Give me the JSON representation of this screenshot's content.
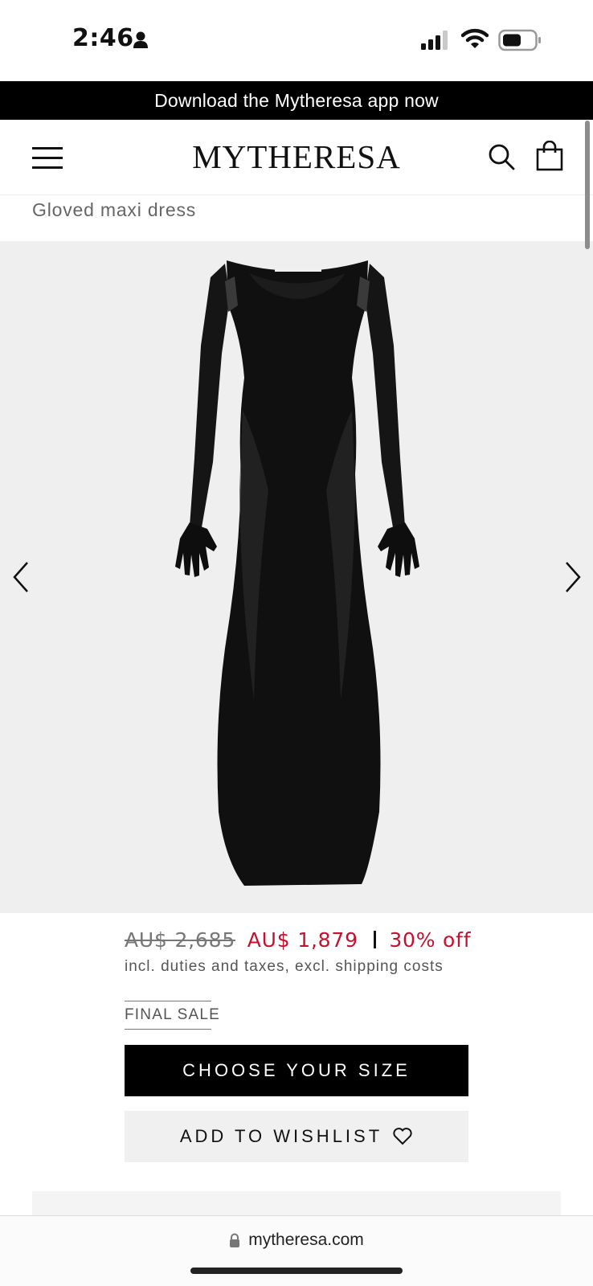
{
  "status_bar": {
    "time": "2:46",
    "icons": [
      "person-icon",
      "signal-icon",
      "wifi-icon",
      "battery-icon"
    ]
  },
  "banner": {
    "text": "Download the Mytheresa app now"
  },
  "header": {
    "logo": "MYTHERESA",
    "icons": [
      "menu-icon",
      "search-icon",
      "shopping-bag-icon"
    ]
  },
  "product": {
    "title": "Gloved maxi dress",
    "image_alt": "Black gloved maxi dress",
    "price_original": "AU$ 2,685",
    "price_sale": "AU$ 1,879",
    "discount": "30% off",
    "tax_note": "incl. duties and taxes, excl. shipping costs",
    "final_sale": "FINAL SALE"
  },
  "actions": {
    "choose_size": "CHOOSE YOUR SIZE",
    "wishlist": "ADD TO WISHLIST"
  },
  "browser": {
    "url": "mytheresa.com"
  },
  "colors": {
    "accent_sale": "#c8102e",
    "banner_bg": "#000000",
    "gallery_bg": "#efefef"
  }
}
